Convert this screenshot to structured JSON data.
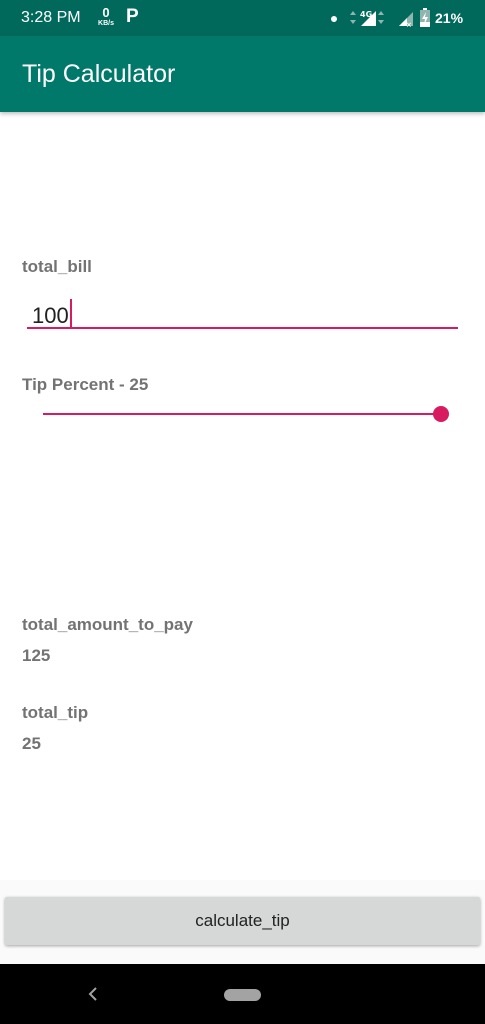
{
  "status_bar": {
    "time": "3:28 PM",
    "speed_value": "0",
    "speed_unit": "KB/s",
    "parking_icon_glyph": "P",
    "network_label": "4G",
    "battery": "21%"
  },
  "app_bar": {
    "title": "Tip Calculator"
  },
  "form": {
    "bill_label": "total_bill",
    "bill_value": "100",
    "tip_label": "Tip Percent - 25",
    "tip_percent": 25,
    "tip_max": 25
  },
  "results": {
    "total_label": "total_amount_to_pay",
    "total_value": "125",
    "tip_label": "total_tip",
    "tip_value": "25"
  },
  "actions": {
    "calculate_label": "calculate_tip"
  },
  "colors": {
    "primary": "#00796b",
    "primary_dark": "#00695c",
    "accent": "#d81b60",
    "button_bg": "#d6d7d7"
  },
  "icons": [
    "data-usage-icon",
    "parking-icon",
    "notification-dot-icon",
    "signal-4g-icon",
    "signal-icon",
    "battery-icon",
    "back-icon",
    "home-icon"
  ]
}
